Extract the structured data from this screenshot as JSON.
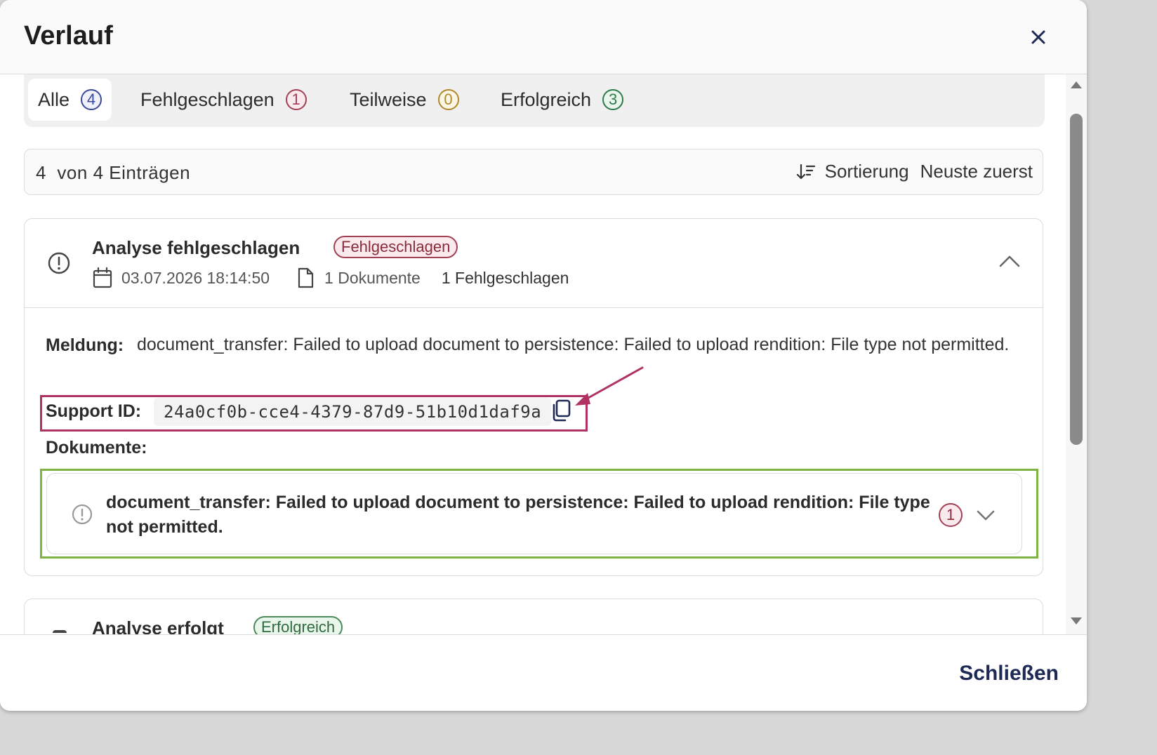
{
  "dialog": {
    "title": "Verlauf",
    "close_label": "Schließen"
  },
  "tabs": [
    {
      "label": "Alle",
      "count": "4",
      "color": "#3b4a9a",
      "active": true
    },
    {
      "label": "Fehlgeschlagen",
      "count": "1",
      "color": "#a24155"
    },
    {
      "label": "Teilweise",
      "count": "0",
      "color": "#b08a2a"
    },
    {
      "label": "Erfolgreich",
      "count": "3",
      "color": "#2e7a4a"
    }
  ],
  "results": {
    "shown": "4",
    "of_text": "von",
    "total": "4",
    "unit": "Einträgen",
    "sort_label": "Sortierung",
    "sort_value": "Neuste zuerst"
  },
  "entries": [
    {
      "title": "Analyse fehlgeschlagen",
      "status": "Fehlgeschlagen",
      "datetime": "03.07.2026 18:14:50",
      "documents": "1 Dokumente",
      "failed": "1 Fehlgeschlagen",
      "message_label": "Meldung:",
      "message": "document_transfer: Failed to upload document to persistence: Failed to upload rendition: File type not permitted.",
      "support_label": "Support ID:",
      "support_id": "24a0cf0b-cce4-4379-87d9-51b10d1daf9a",
      "documents_label": "Dokumente:",
      "document_items": [
        {
          "title": "document_transfer: Failed to upload document to persistence: Failed to upload rendition: File type not permitted.",
          "count": "1"
        }
      ]
    },
    {
      "title": "Analyse erfolgt",
      "status": "Erfolgreich"
    }
  ],
  "colors": {
    "support_highlight": "#b03262",
    "documents_highlight": "#7cb342",
    "fail_badge": "#a24155",
    "success_badge": "#4c8a5c",
    "close_button_text": "#1e2a55"
  },
  "icons": [
    "close-icon",
    "sort-icon",
    "alert-circle-icon",
    "calendar-icon",
    "document-icon",
    "chevron-up-icon",
    "copy-icon",
    "chevron-down-icon"
  ]
}
